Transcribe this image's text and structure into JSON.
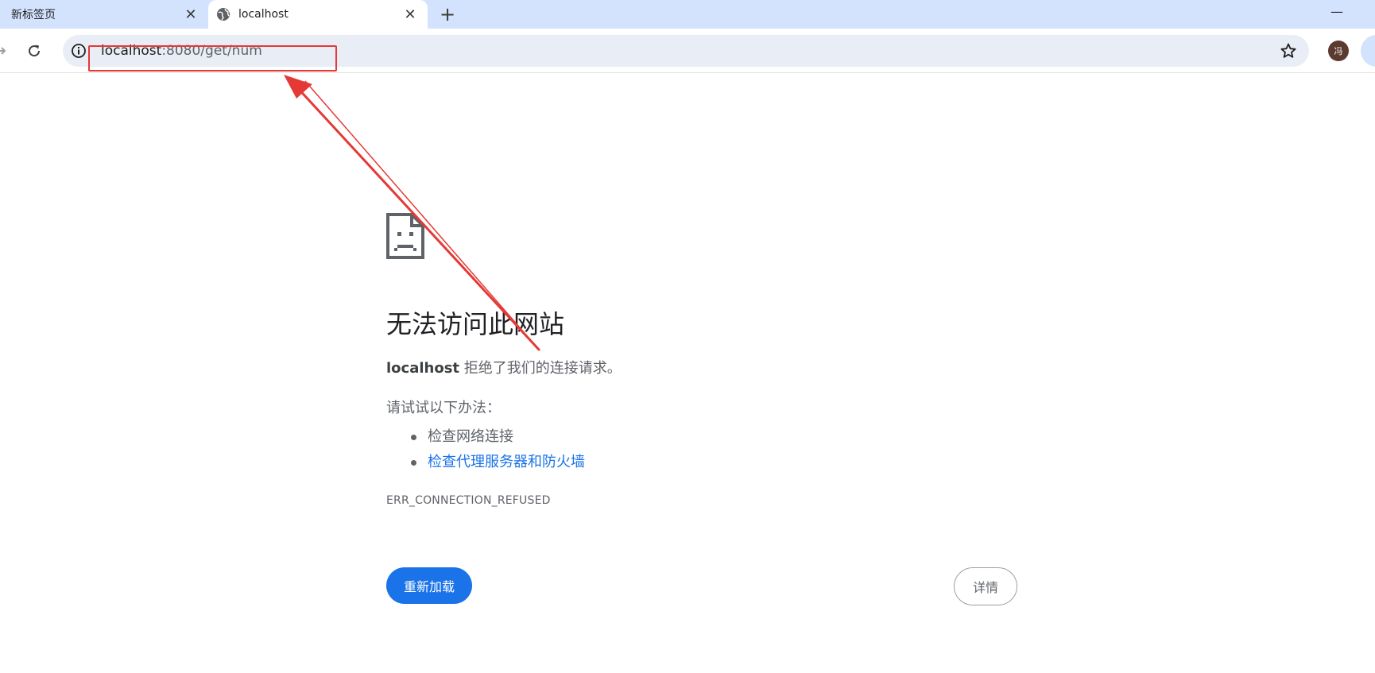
{
  "tabs": [
    {
      "title": "新标签页",
      "close": "✕",
      "active": false
    },
    {
      "title": "localhost",
      "close": "✕",
      "active": true
    }
  ],
  "new_tab": "+",
  "window": {
    "minimize": "—"
  },
  "address_bar": {
    "host": "localhost",
    "rest": ":8080/get/num"
  },
  "profile": {
    "avatar_text": "冯"
  },
  "error_page": {
    "headline": "无法访问此网站",
    "host": "localhost",
    "message": " 拒绝了我们的连接请求。",
    "try_label": "请试试以下办法：",
    "suggestions": [
      "检查网络连接",
      "检查代理服务器和防火墙"
    ],
    "error_code": "ERR_CONNECTION_REFUSED",
    "reload_button": "重新加载",
    "details_button": "详情"
  },
  "colors": {
    "tabstrip": "#d3e3fd",
    "primary_blue": "#1a73e8",
    "annotation_red": "#e53935",
    "avatar": "#5d3a2f"
  },
  "icons": [
    "globe-icon",
    "reload-icon",
    "info-icon",
    "star-icon",
    "sad-page-icon",
    "forward-icon"
  ]
}
